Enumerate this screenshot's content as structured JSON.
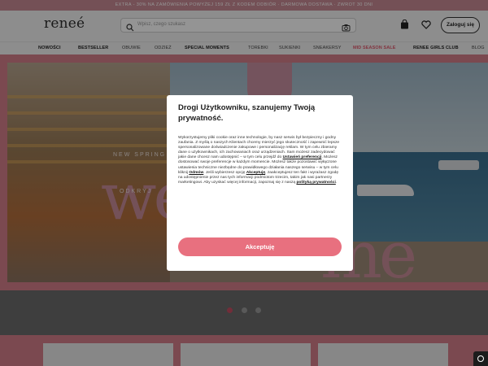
{
  "promo_bar": {
    "text": "EXTRA - 30% NA ZAMÓWIENIA POWYŻEJ 159 ZŁ Z KODEM ODBIÓR · DARMOWA DOSTAWA · ZWROT 30 DNI"
  },
  "header": {
    "logo": "reneé",
    "search": {
      "placeholder": "Wpisz, czego szukasz"
    },
    "icons": [
      "search-icon",
      "camera-icon",
      "bag-icon",
      "heart-icon"
    ],
    "login_label": "Zaloguj się"
  },
  "nav": {
    "items": [
      {
        "label": "NOWOŚCI",
        "style": "bold"
      },
      {
        "label": "BESTSELLER",
        "style": "bold"
      },
      {
        "label": "OBUWIE",
        "style": "light"
      },
      {
        "label": "ODZIEŻ",
        "style": "light"
      },
      {
        "label": "SPECIAL MOMENTS",
        "style": "bold"
      },
      {
        "label": "TOREBKI",
        "style": "light"
      },
      {
        "label": "SUKIENKI",
        "style": "light"
      },
      {
        "label": "SNEAKERSY",
        "style": "light"
      },
      {
        "label": "MID SEASON SALE",
        "style": "sale"
      },
      {
        "label": "RENEE GIRLS CLUB",
        "style": "bold"
      },
      {
        "label": "BLOG",
        "style": "light"
      }
    ]
  },
  "hero": {
    "headline_part1": "we",
    "headline_part2": "me",
    "tagline": "NEW SPRING CA",
    "cta": "ODKRYJ"
  },
  "carousel": {
    "slides": 3,
    "active_index": 0
  },
  "cookie_modal": {
    "title": "Drogi Użytkowniku, szanujemy Twoją prywatność.",
    "paragraph_1": "Wykorzystujemy pliki cookie oraz inne technologie, by nasz serwis był bezpieczny i godny zaufania. Z myślą o naszych Klientach chcemy mierzyć jego skuteczność i zapewnić lepsze spersonalizowane doświadczenie zakupowe i personalizację reklam. W tym celu zbieramy dane o użytkownikach, ich zachowaniach oraz urządzeniach. Sam możesz zadecydować jakie dane chcesz nam udostępnić – w tym celu przejdź do",
    "link_settings": "Ustawień preferencji",
    "paragraph_2": ". Możesz dostosować swoje preferencje w każdym momencie. Możesz także pozostawić wyłączone ustawienia techniczne niezbędne do prawidłowego działania naszego serwisu – w tym celu kliknij",
    "link_reject": "Odmów",
    "paragraph_3": ". Jeśli wybierzesz opcję",
    "link_accept_inline": "Akceptuję",
    "paragraph_4": ", zaakceptujesz ten fakt i wyrażasz zgodę na udostępnienie przez nas tych informacji podmiotom trzecim, takim jak nasi partnerzy marketingowi. Aby uzyskać więcej informacji, zapoznaj się z naszą",
    "link_policy": "polityką prywatności",
    "paragraph_5": ".",
    "accept_label": "Akceptuję"
  },
  "colors": {
    "brand_pink": "#e8707f",
    "band_pink": "#d57e8a",
    "promo_pink": "#c98a94",
    "sale_red": "#e05a6e"
  }
}
